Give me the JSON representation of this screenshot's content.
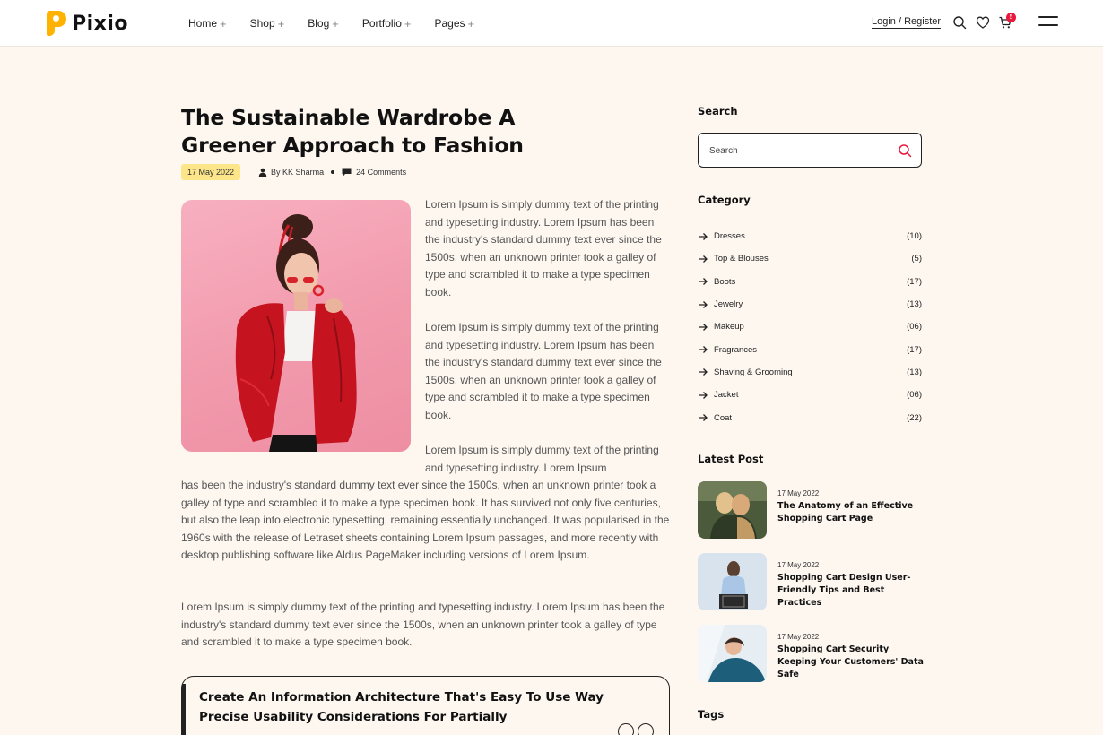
{
  "brand": {
    "name": "Pixio",
    "accent": "#ffb300",
    "badge_color": "#e8193c"
  },
  "nav": {
    "items": [
      {
        "label": "Home"
      },
      {
        "label": "Shop"
      },
      {
        "label": "Blog"
      },
      {
        "label": "Portfolio"
      },
      {
        "label": "Pages"
      }
    ],
    "plus": "+"
  },
  "header": {
    "login_label": "Login / Register",
    "cart_count": "5",
    "icons": [
      "search-icon",
      "heart-icon",
      "cart-icon",
      "menu-icon"
    ]
  },
  "article": {
    "title": "The Sustainable Wardrobe A Greener Approach to Fashion",
    "date": "17 May 2022",
    "author": "By KK Sharma",
    "comments": "24 Comments",
    "paragraphs": [
      "Lorem Ipsum is simply dummy text of the printing and typesetting industry. Lorem Ipsum has been the industry's standard dummy text ever since the 1500s, when an unknown printer took a galley of type and scrambled it to make a type specimen book.",
      "Lorem Ipsum is simply dummy text of the printing and typesetting industry. Lorem Ipsum has been the industry's standard dummy text ever since the 1500s, when an unknown printer took a galley of type and scrambled it to make a type specimen book.",
      "Lorem Ipsum is simply dummy text of the printing and typesetting industry. Lorem Ipsum",
      "has been the industry's standard dummy text ever since the 1500s, when an unknown printer took a galley of type and scrambled it to make a type specimen book. It has survived not only five centuries, but also the leap into electronic typesetting, remaining essentially unchanged. It was popularised in the 1960s with the release of Letraset sheets containing Lorem Ipsum passages, and more recently with desktop publishing software like Aldus PageMaker including versions of Lorem Ipsum.",
      "Lorem Ipsum is simply dummy text of the printing and typesetting industry. Lorem Ipsum has been the industry's standard dummy text ever since the 1500s, when an unknown printer took a galley of type and scrambled it to make a type specimen book."
    ],
    "quote": "Create An Information Architecture That's Easy To Use Way Precise Usability Considerations For Partially"
  },
  "sidebar": {
    "search_heading": "Search",
    "search_placeholder": "Search",
    "category_heading": "Category",
    "categories": [
      {
        "name": "Dresses",
        "count": "(10)"
      },
      {
        "name": "Top & Blouses",
        "count": "(5)"
      },
      {
        "name": "Boots",
        "count": "(17)"
      },
      {
        "name": "Jewelry",
        "count": "(13)"
      },
      {
        "name": "Makeup",
        "count": "(06)"
      },
      {
        "name": "Fragrances",
        "count": "(17)"
      },
      {
        "name": "Shaving & Grooming",
        "count": "(13)"
      },
      {
        "name": "Jacket",
        "count": "(06)"
      },
      {
        "name": "Coat",
        "count": "(22)"
      }
    ],
    "latest_heading": "Latest Post",
    "latest_posts": [
      {
        "date": "17 May 2022",
        "title": "The Anatomy of an Effective Shopping Cart Page"
      },
      {
        "date": "17 May 2022",
        "title": "Shopping Cart Design User-Friendly Tips and Best Practices"
      },
      {
        "date": "17 May 2022",
        "title": "Shopping Cart Security Keeping Your Customers' Data Safe"
      }
    ],
    "tags_heading": "Tags"
  }
}
